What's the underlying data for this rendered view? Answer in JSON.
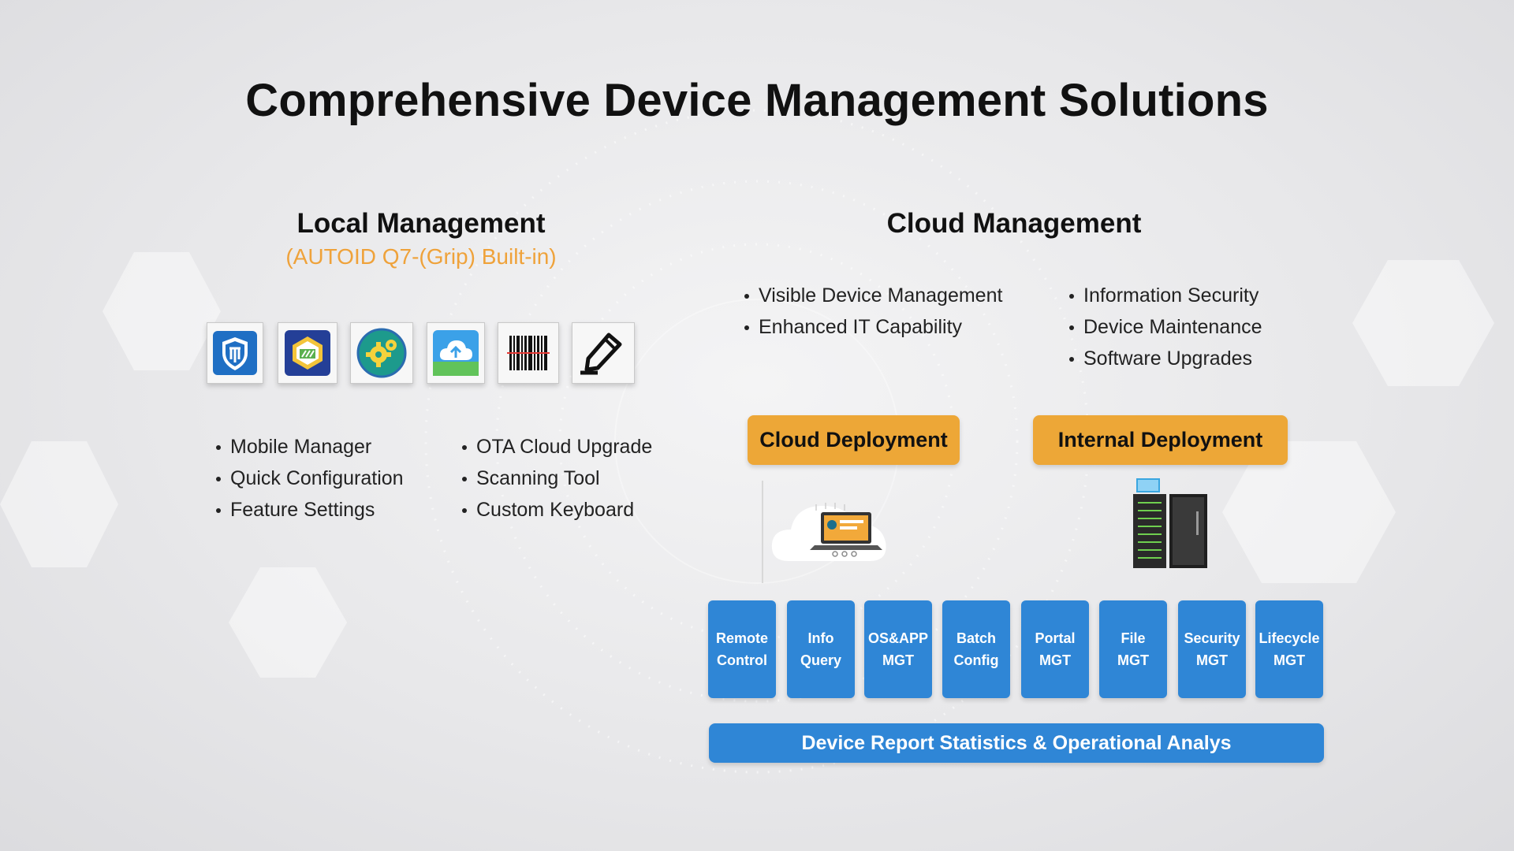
{
  "title": "Comprehensive Device Management Solutions",
  "local": {
    "title": "Local Management",
    "subtitle": "(AUTOID Q7-(Grip) Built-in)",
    "icons": [
      "shield-icon",
      "settings-card-icon",
      "gear-globe-icon",
      "cloud-upload-icon",
      "barcode-icon",
      "pen-icon"
    ],
    "features_left": [
      "Mobile Manager",
      "Quick Configuration",
      "Feature Settings"
    ],
    "features_right": [
      "OTA Cloud Upgrade",
      "Scanning Tool",
      "Custom Keyboard"
    ]
  },
  "cloud": {
    "title": "Cloud Management",
    "features_left": [
      "Visible Device Management",
      "Enhanced IT Capability"
    ],
    "features_right": [
      "Information Security",
      "Device Maintenance",
      "Software Upgrades"
    ],
    "cloud_deployment": "Cloud Deployment",
    "internal_deployment": "Internal Deployment",
    "modules": [
      "Remote\nControl",
      "Info\nQuery",
      "OS&APP\nMGT",
      "Batch\nConfig",
      "Portal\nMGT",
      "File\nMGT",
      "Security\nMGT",
      "Lifecycle\nMGT"
    ],
    "report": "Device Report Statistics & Operational Analys"
  },
  "colors": {
    "accent_orange": "#eda737",
    "subtitle_orange": "#efa23a",
    "tile_blue": "#2f86d6"
  }
}
